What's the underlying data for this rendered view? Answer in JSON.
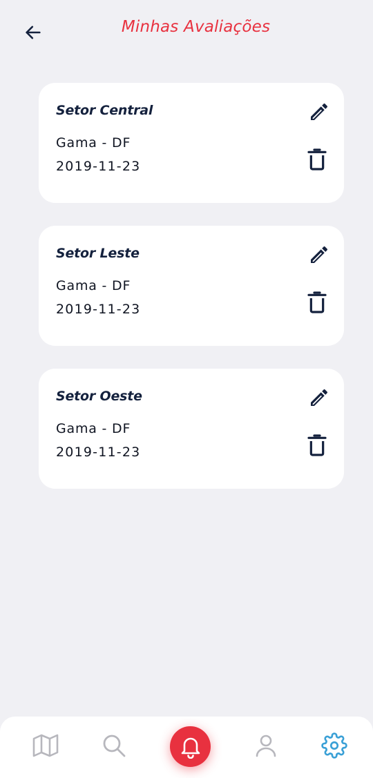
{
  "header": {
    "title": "Minhas Avaliações",
    "back_icon": "arrow-left-icon"
  },
  "colors": {
    "accent": "#e8313f",
    "title_text": "#14213d",
    "background": "#f0f0f4",
    "active_tab": "#3aa0d6",
    "inactive_tab": "#b7b7bd"
  },
  "reviews": [
    {
      "title": "Setor Central",
      "location": "Gama - DF",
      "date": "2019-11-23"
    },
    {
      "title": "Setor Leste",
      "location": "Gama - DF",
      "date": "2019-11-23"
    },
    {
      "title": "Setor Oeste",
      "location": "Gama - DF",
      "date": "2019-11-23"
    }
  ],
  "tabbar": {
    "items": [
      {
        "icon": "map-icon",
        "active": false
      },
      {
        "icon": "search-icon",
        "active": false
      },
      {
        "icon": "bell-icon",
        "active": false,
        "highlighted": true
      },
      {
        "icon": "user-icon",
        "active": false
      },
      {
        "icon": "gear-icon",
        "active": true
      }
    ]
  }
}
